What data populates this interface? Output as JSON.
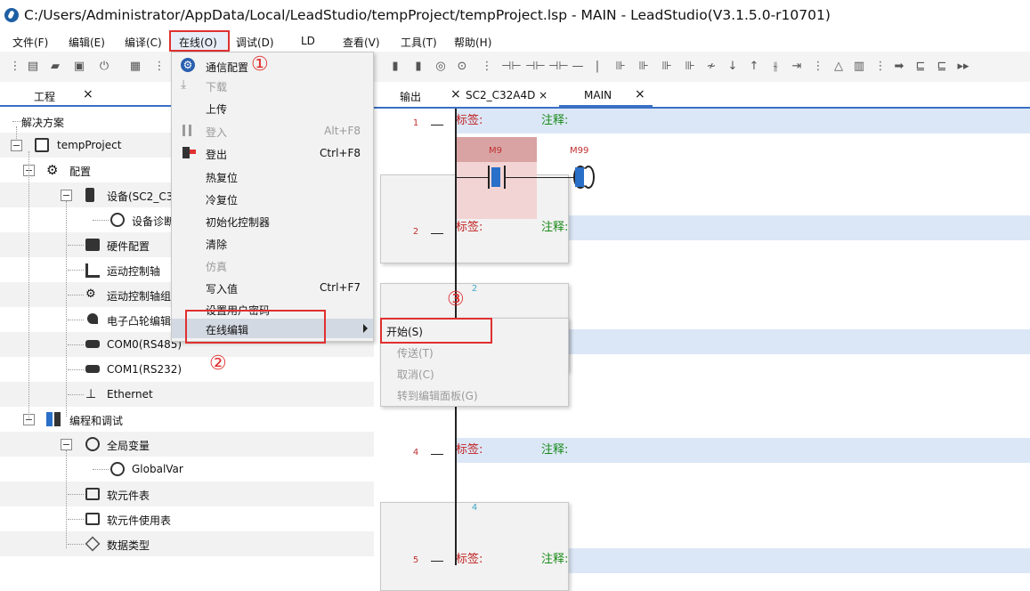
{
  "window": {
    "title": "C:/Users/Administrator/AppData/Local/LeadStudio/tempProject/tempProject.lsp - MAIN - LeadStudio(V3.1.5.0-r10701)"
  },
  "menubar": {
    "items": [
      "文件(F)",
      "编辑(E)",
      "编译(C)",
      "在线(O)",
      "调试(D)",
      "LD",
      "查看(V)",
      "工具(T)",
      "帮助(H)"
    ]
  },
  "left_panel": {
    "tab": "工程",
    "close": "×"
  },
  "tree": [
    {
      "label": "解决方案",
      "icon": "none"
    },
    {
      "label": "tempProject",
      "icon": "document-icon"
    },
    {
      "label": "配置",
      "icon": "gear-icon"
    },
    {
      "label": "设备(SC2_C3",
      "icon": "device-icon"
    },
    {
      "label": "设备诊断",
      "icon": "search-icon"
    },
    {
      "label": "硬件配置",
      "icon": "hardware-icon"
    },
    {
      "label": "运动控制轴",
      "icon": "axis-icon"
    },
    {
      "label": "运动控制轴组",
      "icon": "axis-group-icon"
    },
    {
      "label": "电子凸轮编辑",
      "icon": "cam-icon"
    },
    {
      "label": "COM0(RS485)",
      "icon": "serial-port-icon"
    },
    {
      "label": "COM1(RS232)",
      "icon": "serial-port-icon"
    },
    {
      "label": "Ethernet",
      "icon": "network-icon"
    },
    {
      "label": "编程和调试",
      "icon": "grid-icon"
    },
    {
      "label": "全局变量",
      "icon": "globe-icon"
    },
    {
      "label": "GlobalVar",
      "icon": "globe-icon"
    },
    {
      "label": "软元件表",
      "icon": "table-icon"
    },
    {
      "label": "软元件使用表",
      "icon": "table-icon"
    },
    {
      "label": "数据类型",
      "icon": "datatype-icon"
    }
  ],
  "editor_tabs": [
    {
      "label": "输出"
    },
    {
      "label": "×"
    },
    {
      "label": "SC2_C32A4D ×"
    },
    {
      "label": "MAIN"
    },
    {
      "label": "×"
    }
  ],
  "editor": {
    "rows": [
      {
        "num": "1",
        "label": "标签:",
        "comment": "注释:"
      },
      {
        "num": "2",
        "label": "标签:",
        "comment": "注释:"
      },
      {
        "num": "3",
        "label": "",
        "comment": ""
      },
      {
        "num": "4",
        "label": "标签:",
        "comment": "注释:"
      },
      {
        "num": "5",
        "label": "标签:",
        "comment": "注释:"
      }
    ],
    "sub_nums": [
      "1",
      "2",
      "4"
    ],
    "contact_name": "M9",
    "coil_name": "M99"
  },
  "online_menu": [
    {
      "label": "通信配置",
      "shortcut": "",
      "disabled": false,
      "icon": "gear-icon"
    },
    {
      "label": "下载",
      "shortcut": "",
      "disabled": true,
      "icon": "download-icon"
    },
    {
      "label": "上传",
      "shortcut": "",
      "disabled": false,
      "icon": "none"
    },
    {
      "label": "登入",
      "shortcut": "Alt+F8",
      "disabled": true,
      "icon": "login-icon"
    },
    {
      "label": "登出",
      "shortcut": "Ctrl+F8",
      "disabled": false,
      "icon": "logout-icon"
    },
    {
      "label": "热复位",
      "shortcut": "",
      "disabled": false,
      "icon": "none"
    },
    {
      "label": "冷复位",
      "shortcut": "",
      "disabled": false,
      "icon": "none"
    },
    {
      "label": "初始化控制器",
      "shortcut": "",
      "disabled": false,
      "icon": "none"
    },
    {
      "label": "清除",
      "shortcut": "",
      "disabled": false,
      "icon": "none"
    },
    {
      "label": "仿真",
      "shortcut": "",
      "disabled": true,
      "icon": "none"
    },
    {
      "label": "写入值",
      "shortcut": "Ctrl+F7",
      "disabled": false,
      "icon": "none"
    },
    {
      "label": "设置用户密码",
      "shortcut": "",
      "disabled": false,
      "icon": "none"
    },
    {
      "label": "在线编辑",
      "shortcut": "",
      "disabled": false,
      "icon": "none"
    }
  ],
  "online_edit_submenu": [
    {
      "label": "开始(S)",
      "disabled": false
    },
    {
      "label": "传送(T)",
      "disabled": true
    },
    {
      "label": "取消(C)",
      "disabled": true
    },
    {
      "label": "转到编辑面板(G)",
      "disabled": true
    }
  ],
  "callouts": [
    "①",
    "②",
    "③"
  ],
  "colors": {
    "highlight_red": "#e03030",
    "accent_blue": "#3a6fc4",
    "label_red": "#c02020",
    "comment_green": "#1a8a1a"
  }
}
